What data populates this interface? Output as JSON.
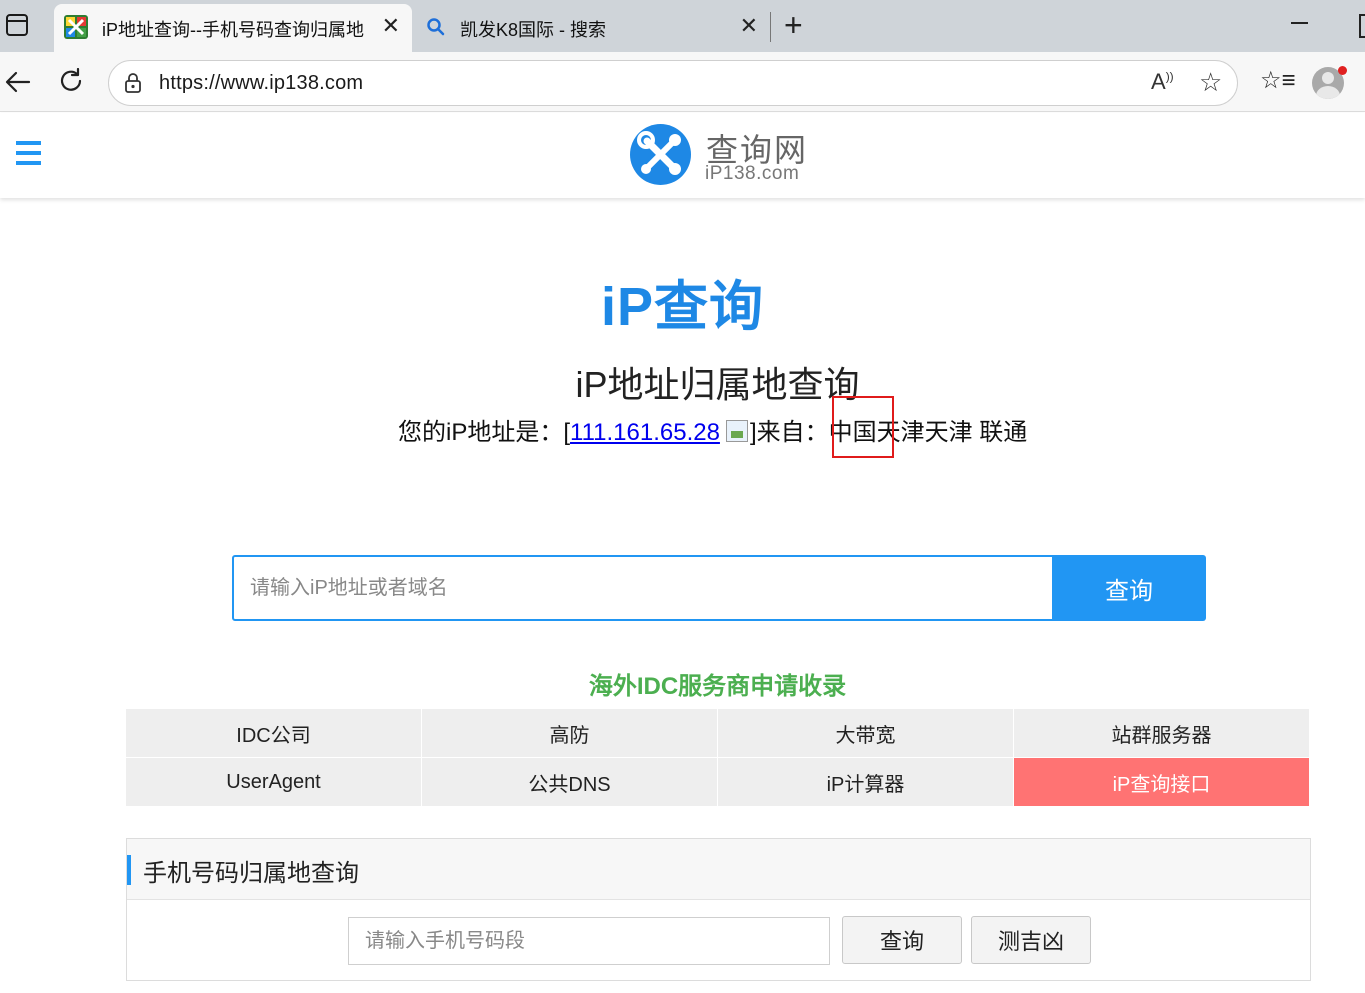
{
  "browser": {
    "tabs": [
      {
        "title": "iP地址查询--手机号码查询归属地",
        "active": true,
        "favicon": "ip138-logo-icon"
      },
      {
        "title": "凯发K8国际 - 搜索",
        "active": false,
        "favicon": "search-icon"
      }
    ],
    "url": "https://www.ip138.com"
  },
  "site": {
    "logo_name": "查询网",
    "logo_domain": "iP138.com",
    "brand_color": "#1e88e5"
  },
  "main": {
    "hero_title": "iP查询",
    "subtitle": "iP地址归属地查询",
    "ip_prefix": "您的iP地址是：[",
    "ip_address": "111.161.65.28",
    "ip_from": "]来自：",
    "location": "中国天津天津 联通",
    "search_placeholder": "请输入iP地址或者域名",
    "search_button": "查询"
  },
  "idc": {
    "title": "海外IDC服务商申请收录",
    "links": [
      {
        "label": "IDC公司"
      },
      {
        "label": "高防"
      },
      {
        "label": "大带宽"
      },
      {
        "label": "站群服务器"
      },
      {
        "label": "UserAgent"
      },
      {
        "label": "公共DNS"
      },
      {
        "label": "iP计算器"
      },
      {
        "label": "iP查询接口",
        "highlight": true
      }
    ]
  },
  "phone": {
    "title": "手机号码归属地查询",
    "placeholder": "请输入手机号码段",
    "query_button": "查询",
    "fortune_button": "测吉凶"
  }
}
